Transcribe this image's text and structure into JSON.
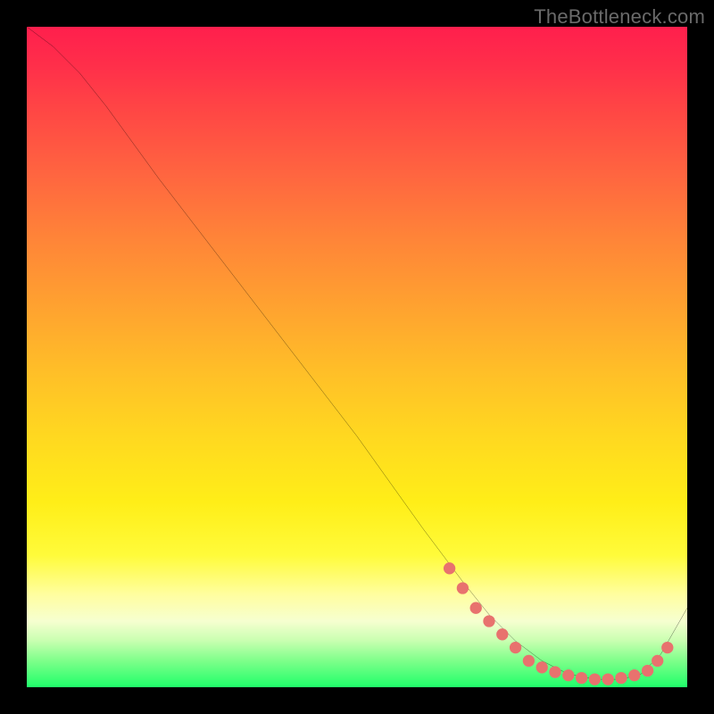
{
  "watermark": "TheBottleneck.com",
  "chart_data": {
    "type": "line",
    "title": "",
    "xlabel": "",
    "ylabel": "",
    "xlim": [
      0,
      100
    ],
    "ylim": [
      0,
      100
    ],
    "grid": false,
    "legend": false,
    "series": [
      {
        "name": "bottleneck-curve",
        "x": [
          0,
          4,
          8,
          12,
          20,
          30,
          40,
          50,
          60,
          66,
          70,
          74,
          78,
          82,
          86,
          90,
          93,
          96,
          100
        ],
        "y": [
          100,
          97,
          93,
          88,
          77,
          64,
          51,
          38,
          24,
          16,
          11,
          7,
          4,
          2,
          1.2,
          1.2,
          2,
          5,
          12
        ]
      }
    ],
    "highlight_dots": {
      "name": "marked-range",
      "x": [
        64,
        66,
        68,
        70,
        72,
        74,
        76,
        78,
        80,
        82,
        84,
        86,
        88,
        90,
        92,
        94,
        95.5,
        97
      ],
      "y": [
        18,
        15,
        12,
        10,
        8,
        6,
        4,
        3,
        2.3,
        1.8,
        1.4,
        1.2,
        1.2,
        1.4,
        1.8,
        2.5,
        4,
        6
      ]
    },
    "gradient_stops": [
      {
        "pos": 0,
        "color": "#ff1f4d"
      },
      {
        "pos": 50,
        "color": "#ffd820"
      },
      {
        "pos": 90,
        "color": "#f6ffd0"
      },
      {
        "pos": 100,
        "color": "#1fff6a"
      }
    ]
  }
}
